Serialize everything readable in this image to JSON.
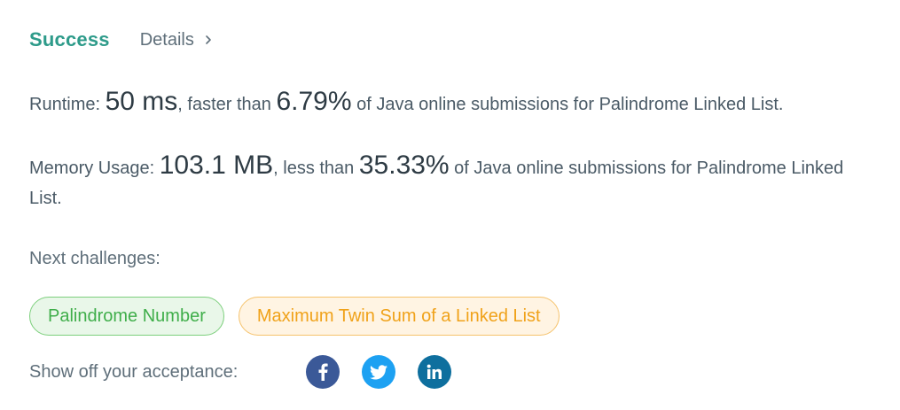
{
  "header": {
    "status": "Success",
    "details_label": "Details"
  },
  "runtime": {
    "label": "Runtime: ",
    "value": "50 ms",
    "middle": ", faster than ",
    "percent": "6.79%",
    "suffix": " of Java online submissions for Palindrome Linked List."
  },
  "memory": {
    "label": "Memory Usage: ",
    "value": "103.1 MB",
    "middle": ", less than ",
    "percent": "35.33%",
    "suffix": " of Java online submissions for Palindrome Linked List."
  },
  "next_challenges": {
    "label": "Next challenges:",
    "items": [
      {
        "title": "Palindrome Number",
        "difficulty": "easy"
      },
      {
        "title": "Maximum Twin Sum of a Linked List",
        "difficulty": "medium"
      }
    ]
  },
  "share": {
    "label": "Show off your acceptance:",
    "icons": [
      "facebook-icon",
      "twitter-icon",
      "linkedin-icon"
    ]
  },
  "colors": {
    "success": "#2e9b8a",
    "easy": "#3fae4a",
    "medium": "#f0a21a",
    "facebook": "#3b5998",
    "twitter": "#1da1f2",
    "linkedin": "#0e6f9e"
  }
}
